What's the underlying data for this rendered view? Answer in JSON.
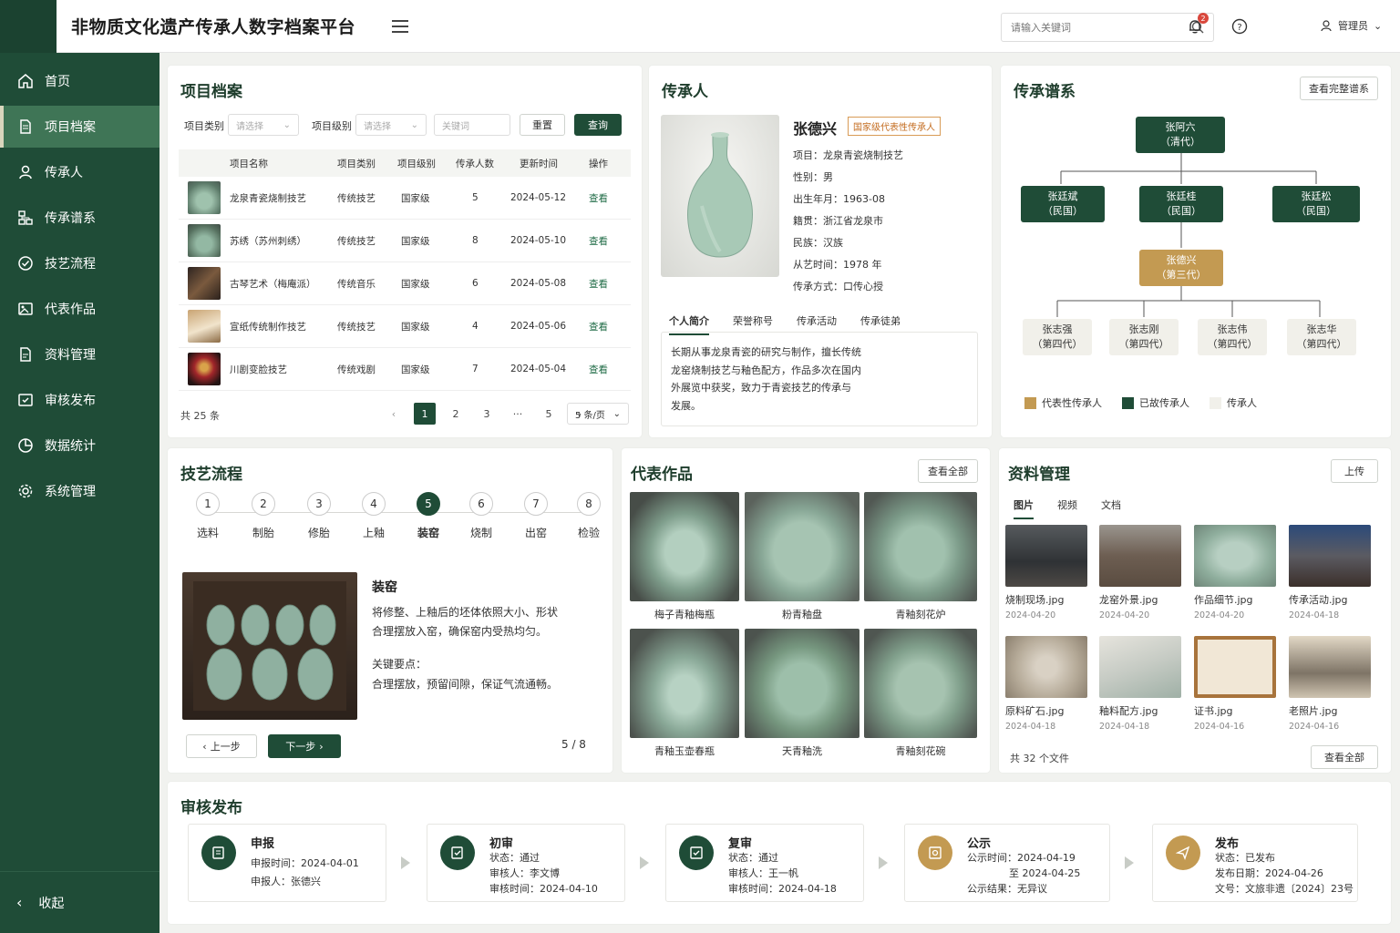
{
  "app": {
    "title": "非物质文化遗产传承人数字档案平台",
    "search_placeholder": "请输入关键词",
    "notifications": "2",
    "user": "管理员"
  },
  "sidebar": {
    "items": [
      {
        "label": "首页",
        "icon": "home-icon"
      },
      {
        "label": "项目档案",
        "icon": "document-icon"
      },
      {
        "label": "传承人",
        "icon": "person-icon"
      },
      {
        "label": "传承谱系",
        "icon": "tree-icon"
      },
      {
        "label": "技艺流程",
        "icon": "check-circle-icon"
      },
      {
        "label": "代表作品",
        "icon": "image-icon"
      },
      {
        "label": "资料管理",
        "icon": "file-icon"
      },
      {
        "label": "审核发布",
        "icon": "approve-icon"
      },
      {
        "label": "数据统计",
        "icon": "chart-icon"
      },
      {
        "label": "系统管理",
        "icon": "gear-icon"
      }
    ],
    "collapse": "收起"
  },
  "projects": {
    "title": "项目档案",
    "filters": {
      "type_label": "项目类别",
      "type_placeholder": "请选择",
      "level_label": "项目级别",
      "level_placeholder": "请选择",
      "keyword_placeholder": "关键词",
      "reset": "重置",
      "query": "查询"
    },
    "headers": [
      "项目名称",
      "项目类别",
      "项目级别",
      "传承人数",
      "更新时间",
      "操作"
    ],
    "rows": [
      {
        "name": "龙泉青瓷烧制技艺",
        "type": "传统技艺",
        "level": "国家级",
        "count": "5",
        "date": "2024-05-12",
        "action": "查看"
      },
      {
        "name": "苏绣（苏州刺绣）",
        "type": "传统技艺",
        "level": "国家级",
        "count": "8",
        "date": "2024-05-10",
        "action": "查看"
      },
      {
        "name": "古琴艺术（梅庵派）",
        "type": "传统音乐",
        "level": "国家级",
        "count": "6",
        "date": "2024-05-08",
        "action": "查看"
      },
      {
        "name": "宣纸传统制作技艺",
        "type": "传统技艺",
        "level": "国家级",
        "count": "4",
        "date": "2024-05-06",
        "action": "查看"
      },
      {
        "name": "川剧变脸技艺",
        "type": "传统戏剧",
        "level": "国家级",
        "count": "7",
        "date": "2024-05-04",
        "action": "查看"
      }
    ],
    "total": "共 25 条",
    "pages": [
      "1",
      "2",
      "3",
      "···",
      "5"
    ],
    "per_page": "5 条/页"
  },
  "inheritor": {
    "title": "传承人",
    "name": "张德兴",
    "badge": "国家级代表性传承人",
    "fields": [
      "项目：龙泉青瓷烧制技艺",
      "性别：男",
      "出生年月：1963-08",
      "籍贯：浙江省龙泉市",
      "民族：汉族",
      "从艺时间：1978 年",
      "传承方式：口传心授"
    ],
    "tabs": [
      "个人简介",
      "荣誉称号",
      "传承活动",
      "传承徒弟"
    ],
    "bio": [
      "长期从事龙泉青瓷的研究与制作，擅长传统",
      "龙窑烧制技艺与釉色配方，作品多次在国内",
      "外展览中获奖，致力于青瓷技艺的传承与",
      "发展。"
    ]
  },
  "lineage": {
    "title": "传承谱系",
    "view_all": "查看完整谱系",
    "root": {
      "name": "张阿六",
      "gen": "（清代）"
    },
    "second": [
      {
        "name": "张廷斌",
        "gen": "（民国）"
      },
      {
        "name": "张廷桂",
        "gen": "（民国）"
      },
      {
        "name": "张廷松",
        "gen": "（民国）"
      }
    ],
    "third": {
      "name": "张德兴",
      "gen": "（第三代）"
    },
    "fourth": [
      {
        "name": "张志强",
        "gen": "（第四代）"
      },
      {
        "name": "张志刚",
        "gen": "（第四代）"
      },
      {
        "name": "张志伟",
        "gen": "（第四代）"
      },
      {
        "name": "张志华",
        "gen": "（第四代）"
      }
    ],
    "legend": [
      "代表性传承人",
      "已故传承人",
      "传承人"
    ],
    "colors": {
      "gold": "#c39a52",
      "dark": "#1f4c37",
      "light": "#f1f0ea"
    }
  },
  "process": {
    "title": "技艺流程",
    "steps": [
      "选料",
      "制胎",
      "修胎",
      "上釉",
      "装窑",
      "烧制",
      "出窑",
      "检验"
    ],
    "current_title": "装窑",
    "desc": [
      "将修整、上釉后的坯体依照大小、形状",
      "合理摆放入窑，确保窑内受热均匀。"
    ],
    "key_label": "关键要点：",
    "key_text": "合理摆放，预留间隙，保证气流通畅。",
    "prev": "上一步",
    "next": "下一步",
    "progress": "5 / 8"
  },
  "works": {
    "title": "代表作品",
    "view_all": "查看全部",
    "items": [
      "梅子青釉梅瓶",
      "粉青釉盘",
      "青釉刻花炉",
      "青釉玉壶春瓶",
      "天青釉洗",
      "青釉刻花碗"
    ]
  },
  "files": {
    "title": "资料管理",
    "upload": "上传",
    "tabs": [
      "图片",
      "视频",
      "文档"
    ],
    "items": [
      {
        "name": "烧制现场.jpg",
        "date": "2024-04-20"
      },
      {
        "name": "龙窑外景.jpg",
        "date": "2024-04-20"
      },
      {
        "name": "作品细节.jpg",
        "date": "2024-04-20"
      },
      {
        "name": "传承活动.jpg",
        "date": "2024-04-18"
      },
      {
        "name": "原料矿石.jpg",
        "date": "2024-04-18"
      },
      {
        "name": "釉料配方.jpg",
        "date": "2024-04-18"
      },
      {
        "name": "证书.jpg",
        "date": "2024-04-16"
      },
      {
        "name": "老照片.jpg",
        "date": "2024-04-16"
      }
    ],
    "total": "共 32 个文件",
    "view_all": "查看全部"
  },
  "audit": {
    "title": "审核发布",
    "steps": [
      {
        "title": "申报",
        "lines": [
          "申报时间：2024-04-01",
          "申报人：张德兴"
        ]
      },
      {
        "title": "初审",
        "lines": [
          "状态：通过",
          "审核人：李文博",
          "审核时间：2024-04-10"
        ]
      },
      {
        "title": "复审",
        "lines": [
          "状态：通过",
          "审核人：王一帆",
          "审核时间：2024-04-18"
        ]
      },
      {
        "title": "公示",
        "lines": [
          "公示时间：2024-04-19",
          "至 2024-04-25",
          "公示结果：无异议"
        ]
      },
      {
        "title": "发布",
        "lines": [
          "状态：已发布",
          "发布日期：2024-04-26",
          "文号：文旅非遗〔2024〕23号"
        ]
      }
    ]
  }
}
